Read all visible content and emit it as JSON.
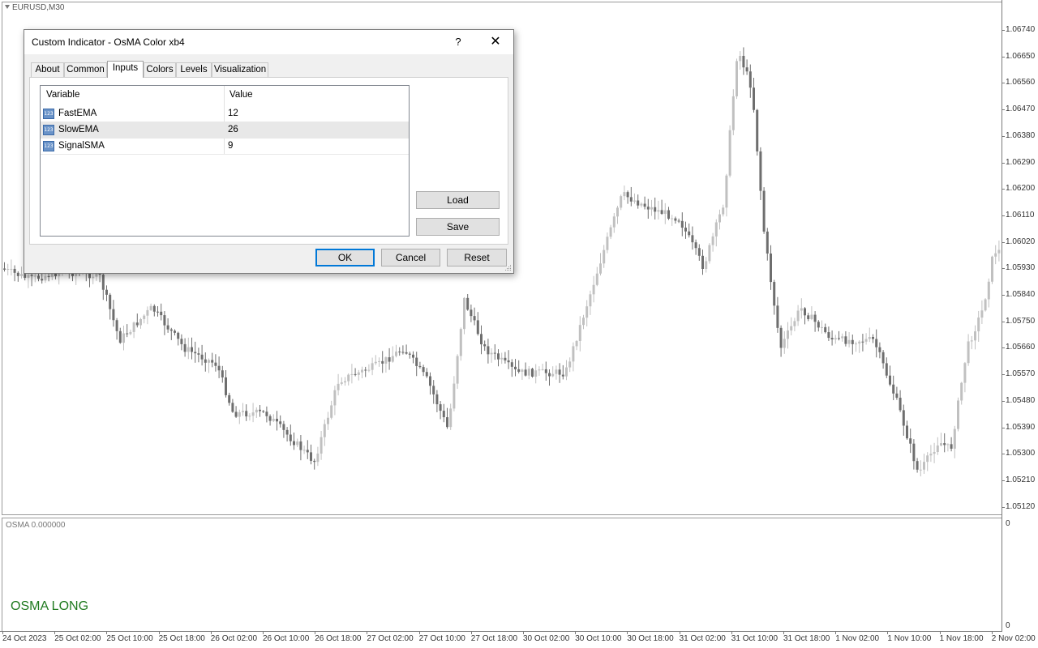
{
  "chart": {
    "symbol": "EURUSD,M30",
    "price_labels": [
      "1.06740",
      "1.06650",
      "1.06560",
      "1.06470",
      "1.06380",
      "1.06290",
      "1.06200",
      "1.06110",
      "1.06020",
      "1.05930",
      "1.05840",
      "1.05750",
      "1.05660",
      "1.05570",
      "1.05480",
      "1.05390",
      "1.05300",
      "1.05210",
      "1.05120"
    ],
    "time_labels": [
      "24 Oct 2023",
      "25 Oct 02:00",
      "25 Oct 10:00",
      "25 Oct 18:00",
      "26 Oct 02:00",
      "26 Oct 10:00",
      "26 Oct 18:00",
      "27 Oct 02:00",
      "27 Oct 10:00",
      "27 Oct 18:00",
      "30 Oct 02:00",
      "30 Oct 10:00",
      "30 Oct 18:00",
      "31 Oct 02:00",
      "31 Oct 10:00",
      "31 Oct 18:00",
      "1 Nov 02:00",
      "1 Nov 10:00",
      "1 Nov 18:00",
      "2 Nov 02:00"
    ],
    "subwindow": {
      "indicator_label": "OSMA 0.000000",
      "signal_text": "OSMA LONG",
      "signal_color": "#1f7a1f",
      "axis_top": "0",
      "axis_bottom": "0"
    },
    "candle_colors": {
      "bull": "#c0c0c0",
      "bear": "#6e6e6e"
    }
  },
  "dialog": {
    "title": "Custom Indicator - OsMA Color xb4",
    "help_glyph": "?",
    "close_glyph": "✕",
    "tabs": [
      "About",
      "Common",
      "Inputs",
      "Colors",
      "Levels",
      "Visualization"
    ],
    "active_tab": "Inputs",
    "grid": {
      "headers": [
        "Variable",
        "Value"
      ],
      "rows": [
        {
          "icon": "123",
          "name": "FastEMA",
          "value": "12",
          "selected": false
        },
        {
          "icon": "123",
          "name": "SlowEMA",
          "value": "26",
          "selected": true
        },
        {
          "icon": "123",
          "name": "SignalSMA",
          "value": "9",
          "selected": false
        }
      ]
    },
    "buttons": {
      "load": "Load",
      "save": "Save",
      "ok": "OK",
      "cancel": "Cancel",
      "reset": "Reset"
    }
  }
}
